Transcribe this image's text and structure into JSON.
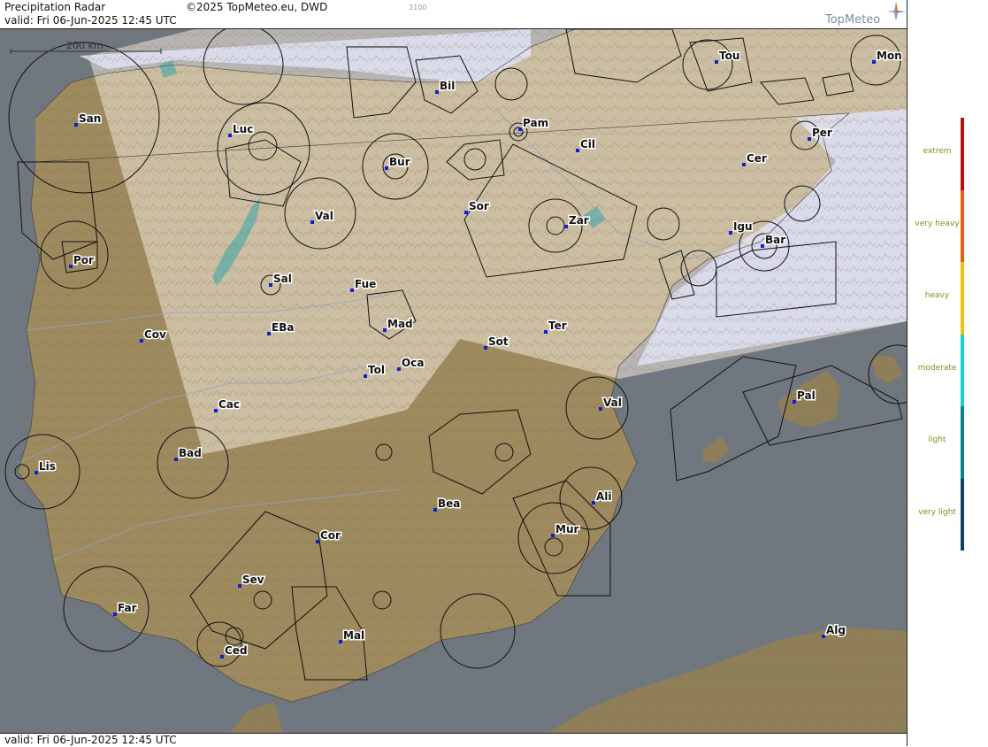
{
  "header": {
    "title": "Precipitation Radar",
    "copyright": "©2025 TopMeteo.eu, DWD",
    "code": "3100",
    "valid": "valid:  Fri  06-Jun-2025 12:45 UTC",
    "logo": "TopMeteo"
  },
  "footer": {
    "valid": "valid:  Fri  06-Jun-2025 12:45 UTC"
  },
  "scale_label": "200 km",
  "legend": {
    "levels": [
      "extrem",
      "very heavy",
      "heavy",
      "moderate",
      "light",
      "very light"
    ],
    "colors": [
      "#b01010",
      "#e06010",
      "#f0c010",
      "#18d0d0",
      "#108090",
      "#104060"
    ]
  },
  "cities": [
    {
      "name": "San"
    },
    {
      "name": "Luc"
    },
    {
      "name": "Bur"
    },
    {
      "name": "Bil"
    },
    {
      "name": "Pam"
    },
    {
      "name": "Tou"
    },
    {
      "name": "Mon"
    },
    {
      "name": "Per"
    },
    {
      "name": "Cil"
    },
    {
      "name": "Cer"
    },
    {
      "name": "Val"
    },
    {
      "name": "Sor"
    },
    {
      "name": "Zar"
    },
    {
      "name": "Igu"
    },
    {
      "name": "Bar"
    },
    {
      "name": "Por"
    },
    {
      "name": "Sal"
    },
    {
      "name": "Fue"
    },
    {
      "name": "Mad"
    },
    {
      "name": "Cov"
    },
    {
      "name": "EBa"
    },
    {
      "name": "Ter"
    },
    {
      "name": "Sot"
    },
    {
      "name": "Tol"
    },
    {
      "name": "Oca"
    },
    {
      "name": "Cac"
    },
    {
      "name": "Val"
    },
    {
      "name": "Pal"
    },
    {
      "name": "Lis"
    },
    {
      "name": "Bad"
    },
    {
      "name": "Ali"
    },
    {
      "name": "Bea"
    },
    {
      "name": "Cor"
    },
    {
      "name": "Mur"
    },
    {
      "name": "Sev"
    },
    {
      "name": "Far"
    },
    {
      "name": "Mal"
    },
    {
      "name": "Ced"
    },
    {
      "name": "Alg"
    }
  ]
}
